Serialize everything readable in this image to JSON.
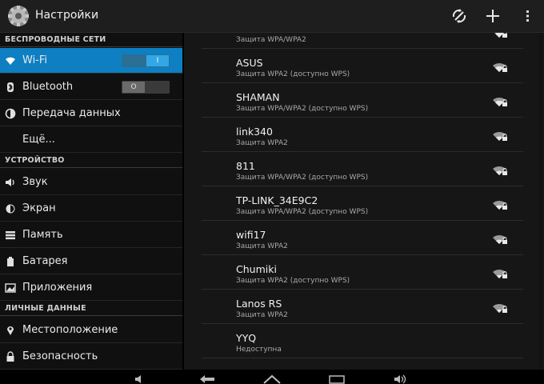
{
  "header": {
    "title": "Настройки",
    "icons": [
      "settings-gear-icon",
      "wifi-refresh-icon",
      "add-icon",
      "overflow-menu-icon"
    ]
  },
  "sidebar": {
    "sections": [
      {
        "header": "БЕСПРОВОДНЫЕ СЕТИ",
        "items": [
          {
            "label": "Wi-Fi",
            "icon": "wifi-icon",
            "toggle": "I",
            "selected": true
          },
          {
            "label": "Bluetooth",
            "icon": "bluetooth-icon",
            "toggle": "O"
          },
          {
            "label": "Передача данных",
            "icon": "data-usage-icon"
          },
          {
            "label": "Ещё..."
          }
        ]
      },
      {
        "header": "УСТРОЙСТВО",
        "items": [
          {
            "label": "Звук",
            "icon": "sound-icon"
          },
          {
            "label": "Экран",
            "icon": "display-icon"
          },
          {
            "label": "Память",
            "icon": "storage-icon"
          },
          {
            "label": "Батарея",
            "icon": "battery-icon"
          },
          {
            "label": "Приложения",
            "icon": "apps-icon"
          }
        ]
      },
      {
        "header": "ЛИЧНЫЕ ДАННЫЕ",
        "items": [
          {
            "label": "Местоположение",
            "icon": "location-icon"
          },
          {
            "label": "Безопасность",
            "icon": "lock-icon"
          }
        ]
      }
    ]
  },
  "networks": [
    {
      "ssid": "",
      "security": "Защита WPA/WPA2"
    },
    {
      "ssid": "ASUS",
      "security": "Защита WPA2 (доступно WPS)"
    },
    {
      "ssid": "SHAMAN",
      "security": "Защита WPA/WPA2 (доступно WPS)"
    },
    {
      "ssid": "link340",
      "security": "Защита WPA2"
    },
    {
      "ssid": "811",
      "security": "Защита WPA/WPA2 (доступно WPS)"
    },
    {
      "ssid": "TP-LINK_34E9C2",
      "security": "Защита WPA/WPA2 (доступно WPS)"
    },
    {
      "ssid": "wifi17",
      "security": "Защита WPA2"
    },
    {
      "ssid": "Chumiki",
      "security": "Защита WPA2 (доступно WPS)"
    },
    {
      "ssid": "Lanos RS",
      "security": "Защита WPA2"
    },
    {
      "ssid": "YYQ",
      "security": "Недоступна"
    }
  ],
  "colors": {
    "accent": "#0e7fc2",
    "toggle_on": "#33a7e6"
  }
}
